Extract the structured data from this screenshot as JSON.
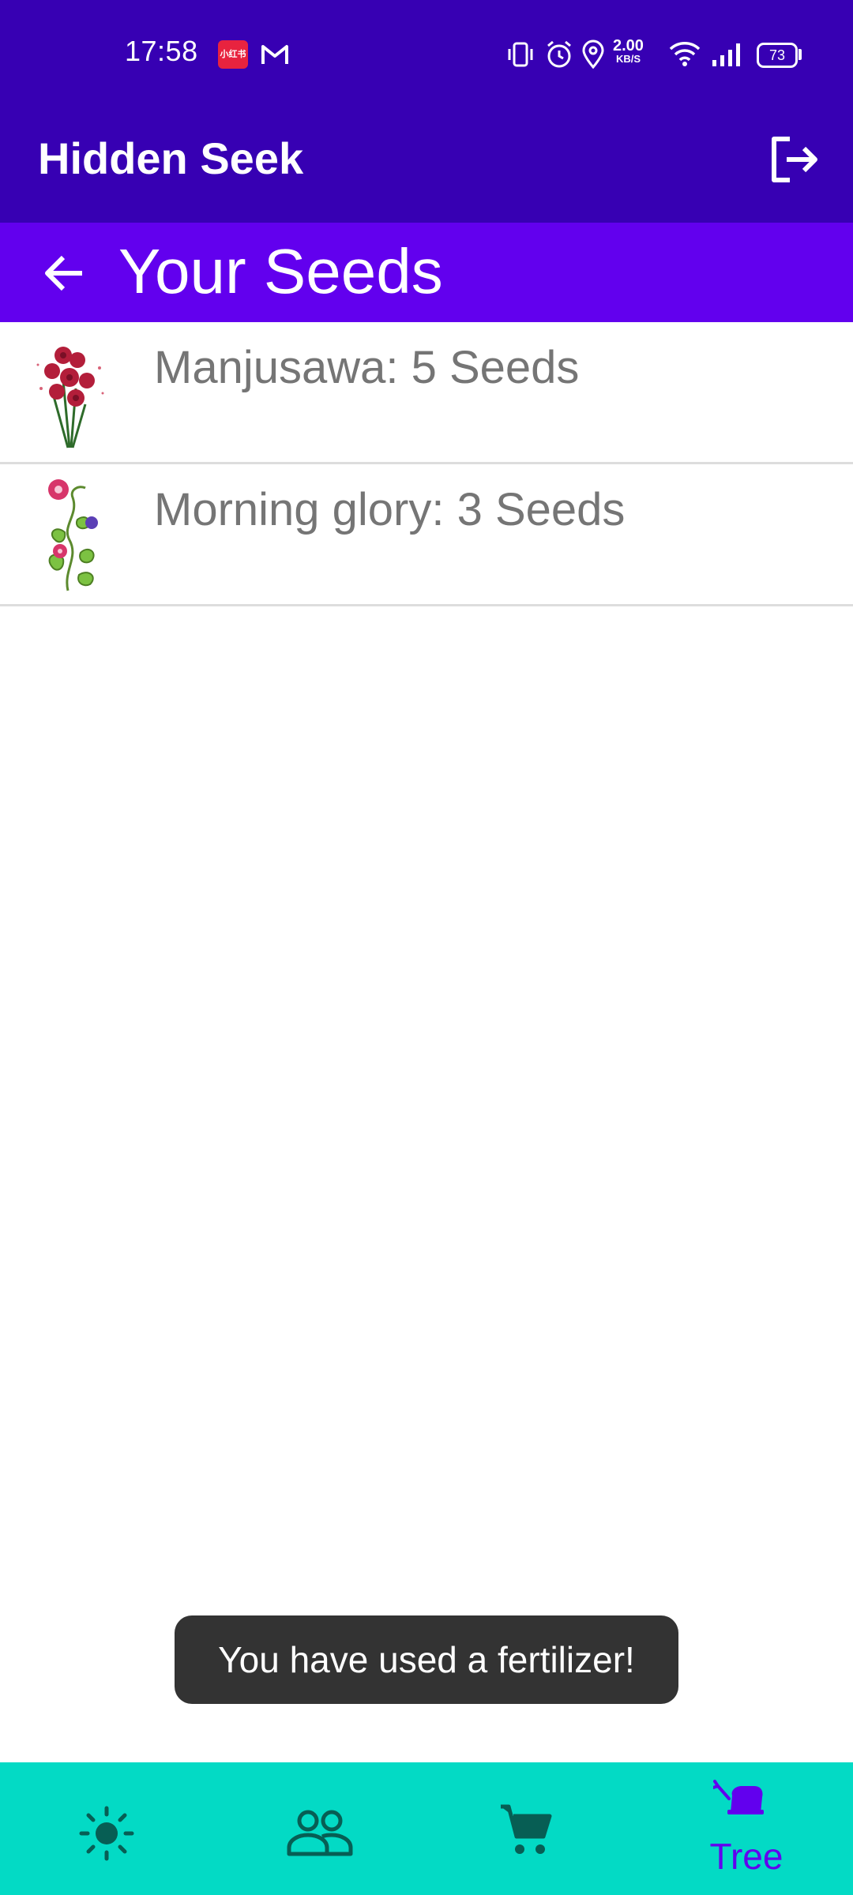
{
  "status_bar": {
    "time": "17:58",
    "notification_badge": "小红书",
    "net_speed_value": "2.00",
    "net_speed_unit": "KB/S",
    "battery": "73"
  },
  "app_bar": {
    "title": "Hidden Seek",
    "logout_icon": "logout-icon"
  },
  "sub_bar": {
    "title": "Your Seeds",
    "back_icon": "arrow-back-icon"
  },
  "seeds": [
    {
      "label": "Manjusawa: 5 Seeds",
      "image": "red-spider-lily-image"
    },
    {
      "label": "Morning glory: 3 Seeds",
      "image": "morning-glory-image"
    }
  ],
  "toast": {
    "message": "You have used a fertilizer!"
  },
  "bottom_nav": {
    "items": [
      {
        "icon": "sun-icon",
        "label": ""
      },
      {
        "icon": "people-icon",
        "label": ""
      },
      {
        "icon": "cart-icon",
        "label": ""
      },
      {
        "icon": "tree-icon",
        "label": "Tree",
        "active": true
      }
    ]
  },
  "colors": {
    "primary_dark": "#3700B3",
    "primary": "#6200EE",
    "nav_background": "#03DAC5",
    "nav_inactive_icon": "#075E54",
    "list_text": "#757575",
    "toast_background": "#333333"
  }
}
